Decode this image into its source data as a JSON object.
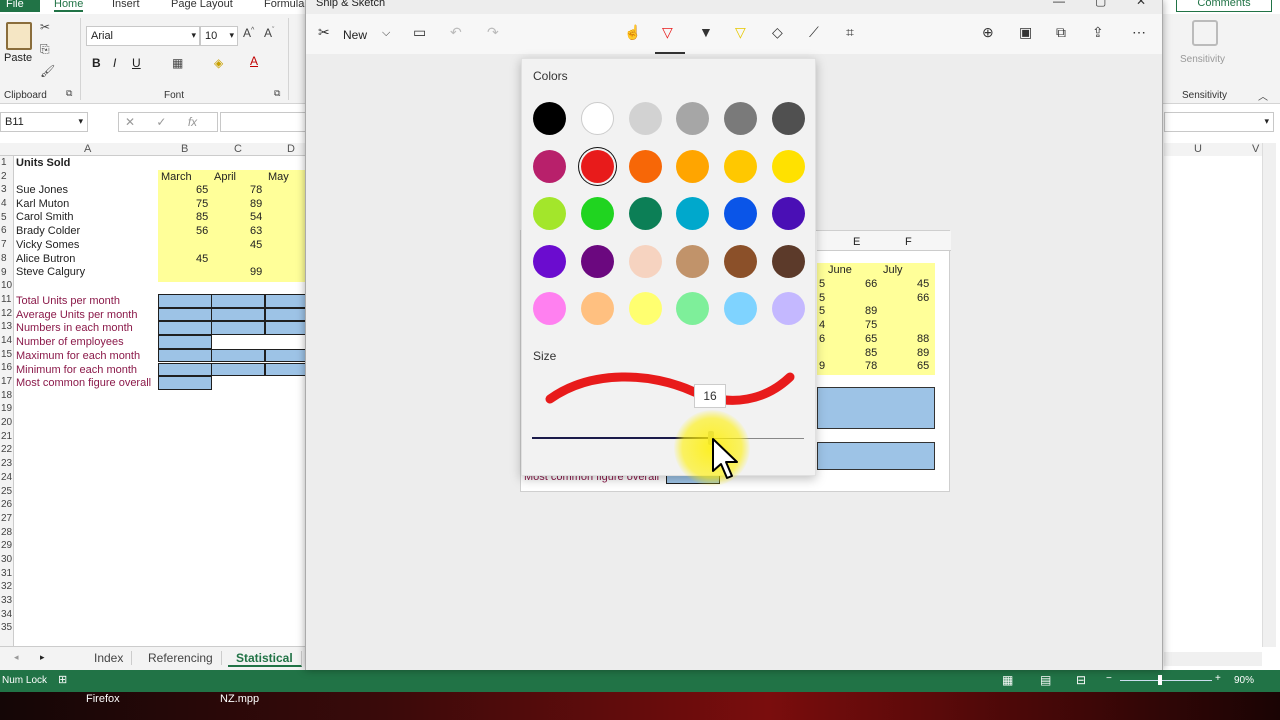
{
  "excel": {
    "menu": {
      "file": "File",
      "tabs": [
        "Home",
        "Insert",
        "Page Layout",
        "Formula"
      ],
      "comments": "Comments"
    },
    "ribbon": {
      "paste": "Paste",
      "font_name": "Arial",
      "font_size": "10",
      "groups": {
        "clipboard": "Clipboard",
        "font": "Font",
        "sensitivity": "Sensitivity"
      },
      "sensitivity_button": "Sensitivity",
      "bold": "B",
      "italic": "I",
      "underline": "U"
    },
    "namebox": "B11",
    "formula_glyphs": {
      "cancel": "✕",
      "enter": "✓",
      "fx": "fx"
    },
    "columns": [
      "A",
      "B",
      "C",
      "D"
    ],
    "right_columns": [
      "U",
      "V"
    ],
    "rows": [
      "1",
      "2",
      "3",
      "4",
      "5",
      "6",
      "7",
      "8",
      "9",
      "10",
      "11",
      "12",
      "13",
      "14",
      "15",
      "16",
      "17",
      "18",
      "19",
      "20",
      "21",
      "22",
      "23",
      "24",
      "25",
      "26",
      "27",
      "28",
      "29",
      "30",
      "31",
      "32",
      "33",
      "34",
      "35"
    ],
    "title": "Units Sold",
    "months": [
      "March",
      "April",
      "May"
    ],
    "employees": [
      {
        "name": "Sue Jones",
        "march": "65",
        "april": "78"
      },
      {
        "name": "Karl Muton",
        "march": "75",
        "april": "89"
      },
      {
        "name": "Carol Smith",
        "march": "85",
        "april": "54"
      },
      {
        "name": "Brady Colder",
        "march": "56",
        "april": "63"
      },
      {
        "name": "Vicky Somes",
        "march": "",
        "april": "45"
      },
      {
        "name": "Alice Butron",
        "march": "45",
        "april": ""
      },
      {
        "name": "Steve Calgury",
        "march": "",
        "april": "99"
      }
    ],
    "stats": [
      "Total Units per month",
      "Average Units per month",
      "Numbers in each month",
      "Number of employees",
      "Maximum for each month",
      "Minimum for each month",
      "Most common figure overall"
    ],
    "sheet_tabs": [
      "Index",
      "Referencing",
      "Statistical"
    ],
    "status": {
      "numlock": "Num Lock",
      "zoom": "90%"
    }
  },
  "taskbar": {
    "items": [
      "Firefox",
      "NZ.mpp"
    ]
  },
  "snip": {
    "title": "Snip & Sketch",
    "new_label": "New",
    "canvas": {
      "columns": [
        "E",
        "F"
      ],
      "months": [
        "June",
        "July"
      ],
      "left_digits": [
        "5",
        "5",
        "5",
        "4",
        "6",
        "",
        "9"
      ],
      "june": [
        "66",
        "",
        "89",
        "75",
        "65",
        "85",
        "78"
      ],
      "july": [
        "45",
        "66",
        "",
        "",
        "88",
        "89",
        "65"
      ],
      "footer_label": "Most common figure overall"
    },
    "flyout": {
      "colors_heading": "Colors",
      "size_heading": "Size",
      "size_value": "16",
      "selected_color": "#e81b1b",
      "swatches": [
        "#000000",
        "#ffffff",
        "#d2d2d2",
        "#a6a6a6",
        "#7a7a7a",
        "#505050",
        "#b8206b",
        "#e81b1b",
        "#f76707",
        "#ffa500",
        "#ffc800",
        "#ffe100",
        "#a3e62b",
        "#20d420",
        "#0c7f56",
        "#00a8cc",
        "#0a55e8",
        "#4a0fb5",
        "#6b0ccf",
        "#6b087f",
        "#f6d3c0",
        "#c1936a",
        "#8b5029",
        "#5c3a2a",
        "#ff80f0",
        "#ffc080",
        "#ffff70",
        "#7eef9a",
        "#7fd3ff",
        "#c4b8ff"
      ]
    }
  }
}
